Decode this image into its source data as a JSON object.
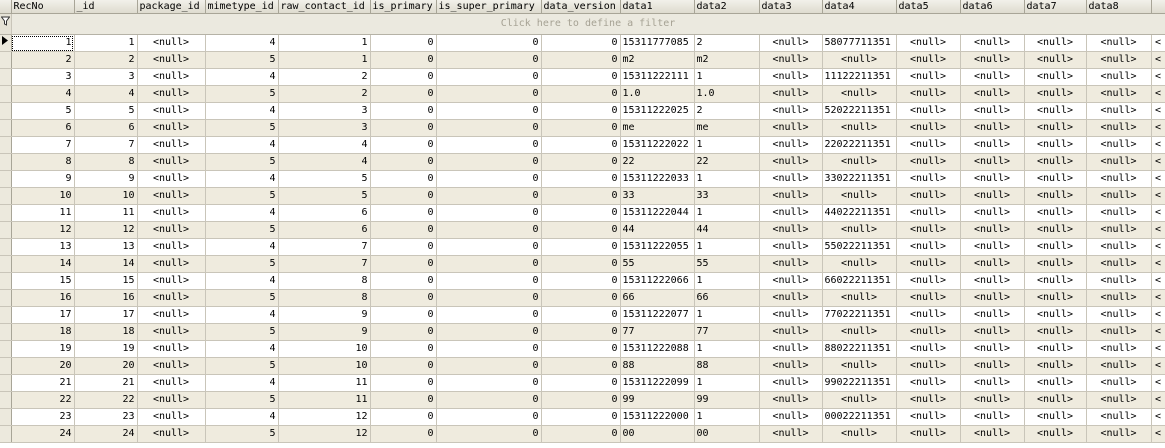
{
  "columns": [
    "RecNo",
    "_id",
    "package_id",
    "mimetype_id",
    "raw_contact_id",
    "is_primary",
    "is_super_primary",
    "data_version",
    "data1",
    "data2",
    "data3",
    "data4",
    "data5",
    "data6",
    "data7",
    "data8"
  ],
  "filter_text": "Click here to define a filter",
  "rows": [
    [
      "1",
      "1",
      "<null>",
      "4",
      "1",
      "0",
      "0",
      "0",
      "15311777085",
      "2",
      "<null>",
      "58077711351",
      "<null>",
      "<null>",
      "<null>",
      "<null>"
    ],
    [
      "2",
      "2",
      "<null>",
      "5",
      "1",
      "0",
      "0",
      "0",
      "m2",
      "m2",
      "<null>",
      "<null>",
      "<null>",
      "<null>",
      "<null>",
      "<null>"
    ],
    [
      "3",
      "3",
      "<null>",
      "4",
      "2",
      "0",
      "0",
      "0",
      "15311222111",
      "1",
      "<null>",
      "11122211351",
      "<null>",
      "<null>",
      "<null>",
      "<null>"
    ],
    [
      "4",
      "4",
      "<null>",
      "5",
      "2",
      "0",
      "0",
      "0",
      "1.0",
      "1.0",
      "<null>",
      "<null>",
      "<null>",
      "<null>",
      "<null>",
      "<null>"
    ],
    [
      "5",
      "5",
      "<null>",
      "4",
      "3",
      "0",
      "0",
      "0",
      "15311222025",
      "2",
      "<null>",
      "52022211351",
      "<null>",
      "<null>",
      "<null>",
      "<null>"
    ],
    [
      "6",
      "6",
      "<null>",
      "5",
      "3",
      "0",
      "0",
      "0",
      "me",
      "me",
      "<null>",
      "<null>",
      "<null>",
      "<null>",
      "<null>",
      "<null>"
    ],
    [
      "7",
      "7",
      "<null>",
      "4",
      "4",
      "0",
      "0",
      "0",
      "15311222022",
      "1",
      "<null>",
      "22022211351",
      "<null>",
      "<null>",
      "<null>",
      "<null>"
    ],
    [
      "8",
      "8",
      "<null>",
      "5",
      "4",
      "0",
      "0",
      "0",
      "22",
      "22",
      "<null>",
      "<null>",
      "<null>",
      "<null>",
      "<null>",
      "<null>"
    ],
    [
      "9",
      "9",
      "<null>",
      "4",
      "5",
      "0",
      "0",
      "0",
      "15311222033",
      "1",
      "<null>",
      "33022211351",
      "<null>",
      "<null>",
      "<null>",
      "<null>"
    ],
    [
      "10",
      "10",
      "<null>",
      "5",
      "5",
      "0",
      "0",
      "0",
      "33",
      "33",
      "<null>",
      "<null>",
      "<null>",
      "<null>",
      "<null>",
      "<null>"
    ],
    [
      "11",
      "11",
      "<null>",
      "4",
      "6",
      "0",
      "0",
      "0",
      "15311222044",
      "1",
      "<null>",
      "44022211351",
      "<null>",
      "<null>",
      "<null>",
      "<null>"
    ],
    [
      "12",
      "12",
      "<null>",
      "5",
      "6",
      "0",
      "0",
      "0",
      "44",
      "44",
      "<null>",
      "<null>",
      "<null>",
      "<null>",
      "<null>",
      "<null>"
    ],
    [
      "13",
      "13",
      "<null>",
      "4",
      "7",
      "0",
      "0",
      "0",
      "15311222055",
      "1",
      "<null>",
      "55022211351",
      "<null>",
      "<null>",
      "<null>",
      "<null>"
    ],
    [
      "14",
      "14",
      "<null>",
      "5",
      "7",
      "0",
      "0",
      "0",
      "55",
      "55",
      "<null>",
      "<null>",
      "<null>",
      "<null>",
      "<null>",
      "<null>"
    ],
    [
      "15",
      "15",
      "<null>",
      "4",
      "8",
      "0",
      "0",
      "0",
      "15311222066",
      "1",
      "<null>",
      "66022211351",
      "<null>",
      "<null>",
      "<null>",
      "<null>"
    ],
    [
      "16",
      "16",
      "<null>",
      "5",
      "8",
      "0",
      "0",
      "0",
      "66",
      "66",
      "<null>",
      "<null>",
      "<null>",
      "<null>",
      "<null>",
      "<null>"
    ],
    [
      "17",
      "17",
      "<null>",
      "4",
      "9",
      "0",
      "0",
      "0",
      "15311222077",
      "1",
      "<null>",
      "77022211351",
      "<null>",
      "<null>",
      "<null>",
      "<null>"
    ],
    [
      "18",
      "18",
      "<null>",
      "5",
      "9",
      "0",
      "0",
      "0",
      "77",
      "77",
      "<null>",
      "<null>",
      "<null>",
      "<null>",
      "<null>",
      "<null>"
    ],
    [
      "19",
      "19",
      "<null>",
      "4",
      "10",
      "0",
      "0",
      "0",
      "15311222088",
      "1",
      "<null>",
      "88022211351",
      "<null>",
      "<null>",
      "<null>",
      "<null>"
    ],
    [
      "20",
      "20",
      "<null>",
      "5",
      "10",
      "0",
      "0",
      "0",
      "88",
      "88",
      "<null>",
      "<null>",
      "<null>",
      "<null>",
      "<null>",
      "<null>"
    ],
    [
      "21",
      "21",
      "<null>",
      "4",
      "11",
      "0",
      "0",
      "0",
      "15311222099",
      "1",
      "<null>",
      "99022211351",
      "<null>",
      "<null>",
      "<null>",
      "<null>"
    ],
    [
      "22",
      "22",
      "<null>",
      "5",
      "11",
      "0",
      "0",
      "0",
      "99",
      "99",
      "<null>",
      "<null>",
      "<null>",
      "<null>",
      "<null>",
      "<null>"
    ],
    [
      "23",
      "23",
      "<null>",
      "4",
      "12",
      "0",
      "0",
      "0",
      "15311222000",
      "1",
      "<null>",
      "00022211351",
      "<null>",
      "<null>",
      "<null>",
      "<null>"
    ],
    [
      "24",
      "24",
      "<null>",
      "5",
      "12",
      "0",
      "0",
      "0",
      "00",
      "00",
      "<null>",
      "<null>",
      "<null>",
      "<null>",
      "<null>",
      "<null>"
    ]
  ],
  "selected_row": 0,
  "icons": {
    "filter": "filter-icon",
    "current_row": "current-row-arrow-icon"
  },
  "colors": {
    "alt_row": "#efebde",
    "grid_line": "#c9c5b9",
    "header": "#dedbcf",
    "filter_text": "#a6a294"
  }
}
